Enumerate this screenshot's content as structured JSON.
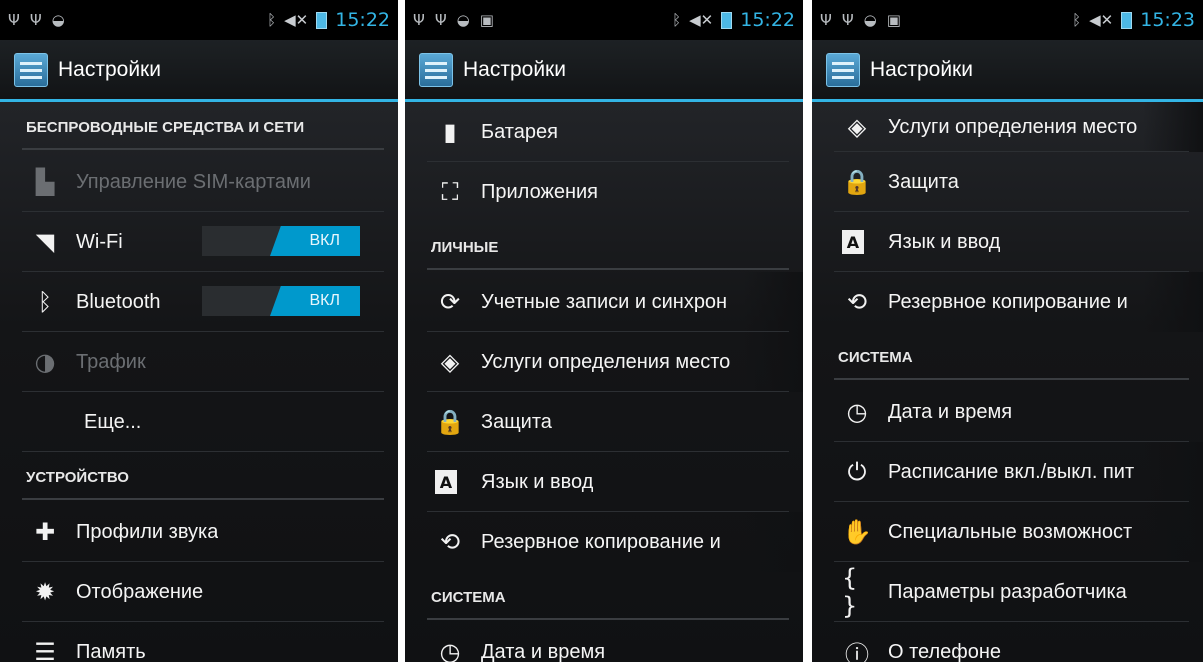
{
  "screens": [
    {
      "status": {
        "time": "15:22"
      },
      "title": "Настройки",
      "items": [
        {
          "kind": "header",
          "label": "БЕСПРОВОДНЫЕ СРЕДСТВА И СЕТИ"
        },
        {
          "kind": "row",
          "icon": "sim-card-icon",
          "glyph": "▙",
          "label": "Управление SIM-картами",
          "disabled": true
        },
        {
          "kind": "row",
          "icon": "wifi-icon",
          "glyph": "◥",
          "label": "Wi-Fi",
          "toggle": "ВКЛ"
        },
        {
          "kind": "row",
          "icon": "bluetooth-icon",
          "glyph": "ᛒ",
          "label": "Bluetooth",
          "toggle": "ВКЛ"
        },
        {
          "kind": "row",
          "icon": "data-usage-icon",
          "glyph": "◑",
          "label": "Трафик",
          "disabled": true
        },
        {
          "kind": "row",
          "icon": "",
          "glyph": "",
          "label": "Еще..."
        },
        {
          "kind": "header",
          "label": "УСТРОЙСТВО"
        },
        {
          "kind": "row",
          "icon": "sound-profiles-icon",
          "glyph": "✚",
          "label": "Профили звука"
        },
        {
          "kind": "row",
          "icon": "display-icon",
          "glyph": "✹",
          "label": "Отображение"
        },
        {
          "kind": "row",
          "icon": "storage-icon",
          "glyph": "☰",
          "label": "Память",
          "last": true
        }
      ]
    },
    {
      "status": {
        "time": "15:22"
      },
      "title": "Настройки",
      "items": [
        {
          "kind": "row",
          "icon": "battery-icon",
          "glyph": "▮",
          "label": "Батарея"
        },
        {
          "kind": "row",
          "icon": "apps-icon",
          "glyph": "⛶",
          "label": "Приложения",
          "last": true
        },
        {
          "kind": "header",
          "label": "ЛИЧНЫЕ"
        },
        {
          "kind": "row",
          "icon": "sync-icon",
          "glyph": "⟳",
          "label": "Учетные записи и синхрон",
          "fade": true
        },
        {
          "kind": "row",
          "icon": "location-icon",
          "glyph": "◈",
          "label": "Услуги определения место",
          "fade": true
        },
        {
          "kind": "row",
          "icon": "lock-icon",
          "glyph": "🔒",
          "label": "Защита"
        },
        {
          "kind": "row",
          "icon": "language-icon",
          "glyph": "A",
          "label": "Язык и ввод"
        },
        {
          "kind": "row",
          "icon": "backup-icon",
          "glyph": "⟲",
          "label": "Резервное копирование и",
          "fade": true,
          "last": true
        },
        {
          "kind": "header",
          "label": "СИСТЕМА"
        },
        {
          "kind": "row",
          "icon": "clock-icon",
          "glyph": "◷",
          "label": "Дата и время",
          "last": true
        }
      ]
    },
    {
      "status": {
        "time": "15:23"
      },
      "title": "Настройки",
      "items": [
        {
          "kind": "row",
          "icon": "location-icon",
          "glyph": "◈",
          "label": "Услуги определения место",
          "fade": true,
          "short": true
        },
        {
          "kind": "row",
          "icon": "lock-icon",
          "glyph": "🔒",
          "label": "Защита"
        },
        {
          "kind": "row",
          "icon": "language-icon",
          "glyph": "A",
          "label": "Язык и ввод"
        },
        {
          "kind": "row",
          "icon": "backup-icon",
          "glyph": "⟲",
          "label": "Резервное копирование и",
          "fade": true,
          "last": true
        },
        {
          "kind": "header",
          "label": "СИСТЕМА"
        },
        {
          "kind": "row",
          "icon": "clock-icon",
          "glyph": "◷",
          "label": "Дата и время"
        },
        {
          "kind": "row",
          "icon": "power-schedule-icon",
          "glyph": "⏻",
          "label": "Расписание вкл./выкл. пит",
          "fade": true
        },
        {
          "kind": "row",
          "icon": "accessibility-icon",
          "glyph": "✋",
          "label": "Специальные возможност",
          "fade": true
        },
        {
          "kind": "row",
          "icon": "developer-options-icon",
          "glyph": "{ }",
          "label": "Параметры разработчика"
        },
        {
          "kind": "row",
          "icon": "about-phone-icon",
          "glyph": "ⓘ",
          "label": "О телефоне",
          "last": true
        }
      ]
    }
  ]
}
